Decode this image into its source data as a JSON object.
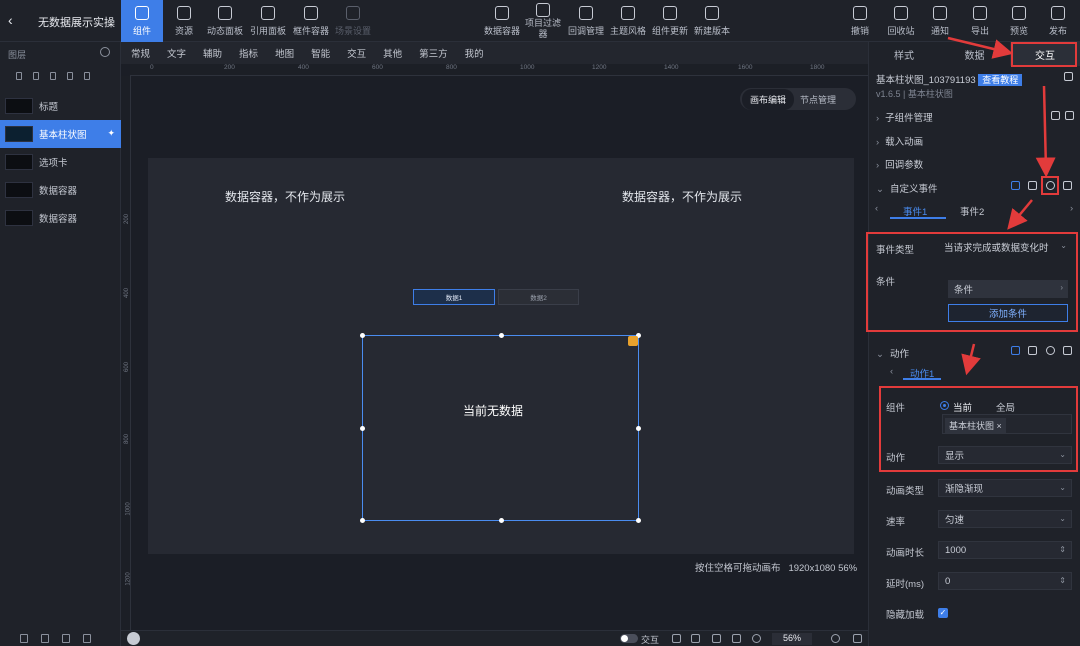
{
  "header": {
    "back_icon": "chevron-left-icon",
    "project_title": "无数据展示实操...",
    "tools_left": [
      {
        "label": "组件",
        "icon": "component-icon"
      },
      {
        "label": "资源",
        "icon": "layers-icon"
      },
      {
        "label": "动态面板",
        "icon": "panel-icon"
      },
      {
        "label": "引用面板",
        "icon": "link-icon"
      },
      {
        "label": "框件容器",
        "icon": "container-icon"
      },
      {
        "label": "场景设置",
        "icon": "scene-icon"
      }
    ],
    "tools_mid": [
      {
        "label": "数据容器",
        "icon": "database-icon"
      },
      {
        "label": "项目过滤器",
        "icon": "filter-icon"
      },
      {
        "label": "回调管理",
        "icon": "callback-icon"
      },
      {
        "label": "主题风格",
        "icon": "theme-icon"
      },
      {
        "label": "组件更新",
        "icon": "refresh-icon"
      },
      {
        "label": "新建版本",
        "icon": "version-icon"
      }
    ],
    "tools_right": [
      {
        "label": "撤销",
        "icon": "undo-icon"
      },
      {
        "label": "回收站",
        "icon": "trash-icon"
      },
      {
        "label": "通知",
        "icon": "bell-icon"
      },
      {
        "label": "导出",
        "icon": "export-icon"
      },
      {
        "label": "预览",
        "icon": "preview-icon"
      },
      {
        "label": "发布",
        "icon": "send-icon"
      }
    ]
  },
  "layers": {
    "title": "图层",
    "items": [
      {
        "label": "标题"
      },
      {
        "label": "基本柱状图",
        "selected": true
      },
      {
        "label": "选项卡"
      },
      {
        "label": "数据容器"
      },
      {
        "label": "数据容器"
      }
    ]
  },
  "component_categories": [
    "常规",
    "文字",
    "辅助",
    "指标",
    "地图",
    "智能",
    "交互",
    "其他",
    "第三方",
    "我的"
  ],
  "ruler": {
    "h_ticks": [
      "0",
      "200",
      "400",
      "600",
      "800",
      "1000",
      "1200",
      "1400",
      "1600",
      "1800"
    ],
    "v_ticks": [
      "200",
      "400",
      "600",
      "800",
      "1000",
      "1200"
    ]
  },
  "canvas": {
    "mode_edit": "画布编辑",
    "mode_nodes": "节点管理",
    "container_text_left": "数据容器，不作为展示",
    "container_text_right": "数据容器，不作为展示",
    "tab1": "数据1",
    "tab2": "数据2",
    "no_data": "当前无数据",
    "status": "按住空格可拖动画布",
    "resolution": "1920x1080",
    "zoom_pct": "56%"
  },
  "bottombar": {
    "toggle_label": "交互",
    "zoom": "56%"
  },
  "right_panel": {
    "tabs": [
      "样式",
      "数据",
      "交互"
    ],
    "component_name": "基本柱状图_103791193",
    "doc_button": "查看教程",
    "version": "v1.6.5 | 基本柱状图",
    "sections": [
      "子组件管理",
      "载入动画",
      "回调参数",
      "自定义事件"
    ],
    "event_tabs": [
      "事件1",
      "事件2"
    ],
    "event_type_label": "事件类型",
    "event_type_value": "当请求完成或数据变化时",
    "condition_label": "条件",
    "condition_value": "条件",
    "add_condition": "添加条件",
    "action_section": "动作",
    "action_tab": "动作1",
    "component_label": "组件",
    "radio_current": "当前",
    "radio_global": "全局",
    "component_tag": "基本柱状图",
    "action_label": "动作",
    "action_value": "显示",
    "anim_type_label": "动画类型",
    "anim_type_value": "渐隐渐现",
    "speed_label": "速率",
    "speed_value": "匀速",
    "duration_label": "动画时长",
    "duration_value": "1000",
    "delay_label": "延时(ms)",
    "delay_value": "0",
    "hide_load_label": "隐藏加载",
    "hide_load_checked": true
  },
  "annotation_color": "#e23b3b",
  "accent": "#3e7ee8"
}
